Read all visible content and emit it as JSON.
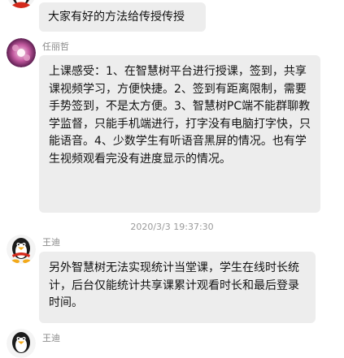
{
  "messages": [
    {
      "text": "大家有好的方法给传授传授"
    },
    {
      "sender": "任丽哲",
      "text": "上课感受：1、在智慧树平台进行授课，签到，共享课视频学习，方便快捷。2、签到有距离限制，需要手势签到，不是太方便。3、智慧树PC端不能群聊教学监督，只能手机端进行，打字没有电脑打字快，只能语音。4、少数学生有听语音黑屏的情况。也有学生视频观看完没有进度显示的情况。"
    },
    {
      "timestamp": "2020/3/3 19:37:30"
    },
    {
      "sender": "王迪",
      "text": "另外智慧树无法实现统计当堂课，学生在线时长统计，后台仅能统计共享课累计观看时长和最后登录时间。"
    },
    {
      "sender": "王迪"
    }
  ],
  "colors": {
    "bubble": "#ededed",
    "name": "#8a8a8a"
  }
}
